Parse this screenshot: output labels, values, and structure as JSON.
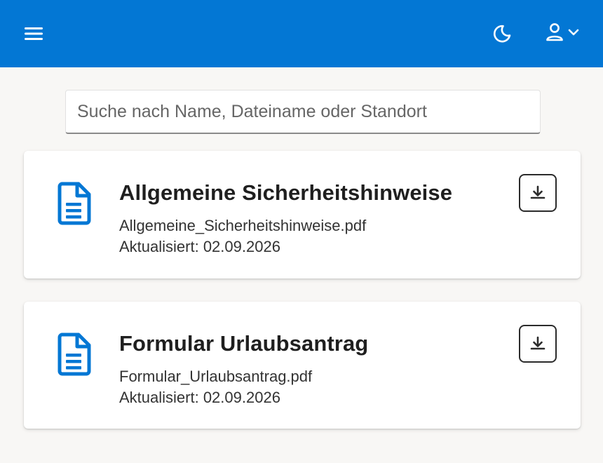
{
  "colors": {
    "header_bg": "#0377d4",
    "page_bg": "#f8f7f5",
    "doc_icon": "#0377d4",
    "card_bg": "#ffffff"
  },
  "header": {
    "menu_icon": "hamburger-menu-icon",
    "theme_icon": "moon-icon",
    "user_icon": "person-icon",
    "user_chevron": "chevron-down-icon"
  },
  "search": {
    "placeholder": "Suche nach Name, Dateiname oder Standort",
    "value": ""
  },
  "documents": [
    {
      "title": "Allgemeine Sicherheitshinweise",
      "filename": "Allgemeine_Sicherheitshinweise.pdf",
      "updated": "Aktualisiert: 02.09.2026",
      "icon": "document-icon",
      "action_icon": "download-icon"
    },
    {
      "title": "Formular Urlaubsantrag",
      "filename": "Formular_Urlaubsantrag.pdf",
      "updated": "Aktualisiert: 02.09.2026",
      "icon": "document-icon",
      "action_icon": "download-icon"
    }
  ]
}
